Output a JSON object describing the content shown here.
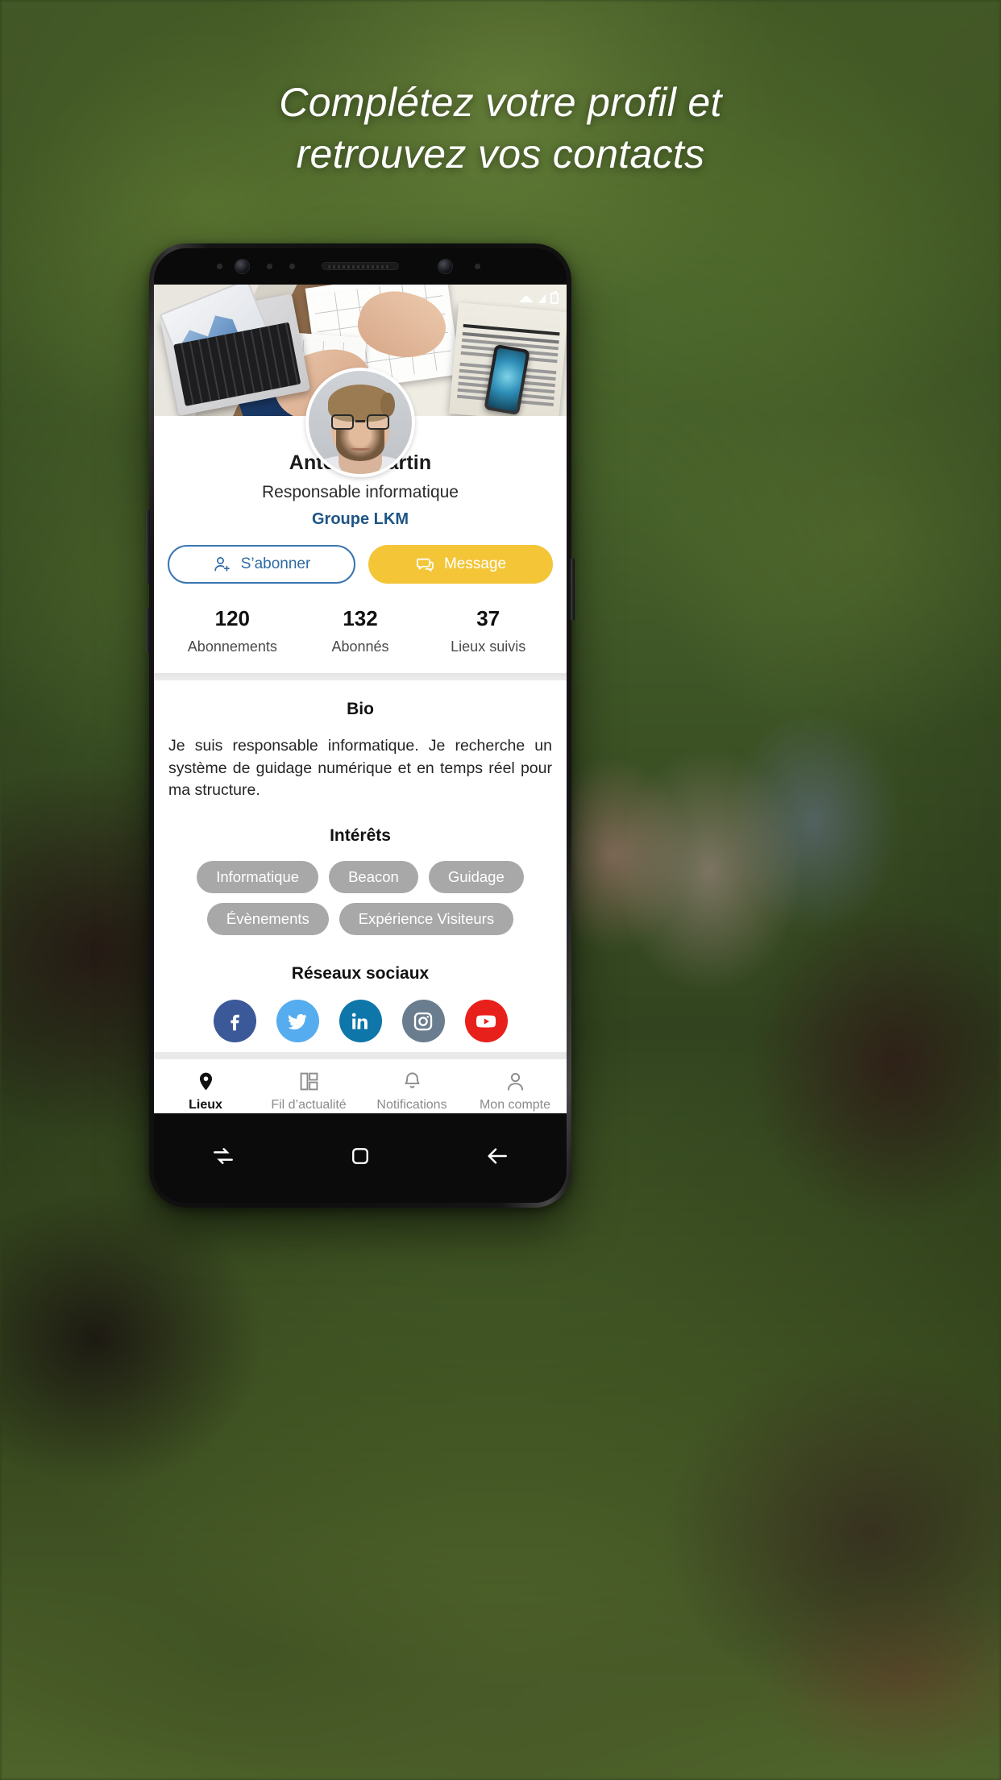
{
  "headline": {
    "line1": "Complétez votre profil et",
    "line2": "retrouvez vos contacts"
  },
  "status_bar": {
    "wifi_icon": "wifi-icon",
    "signal_icon": "signal-icon",
    "battery_icon": "battery-icon"
  },
  "profile": {
    "name": "Antoine Martin",
    "role": "Responsable informatique",
    "company": "Groupe LKM",
    "avatar_icon": "avatar",
    "actions": {
      "subscribe_label": "S’abonner",
      "subscribe_icon": "person-add-icon",
      "message_label": "Message",
      "message_icon": "chat-bubble-icon",
      "subscribe_color": "#2f6ba6",
      "message_color": "#f3c537"
    },
    "stats": [
      {
        "value": "120",
        "label": "Abonnements"
      },
      {
        "value": "132",
        "label": "Abonnés"
      },
      {
        "value": "37",
        "label": "Lieux suivis"
      }
    ]
  },
  "bio": {
    "title": "Bio",
    "text": "Je suis responsable informatique. Je recherche un système de guidage numérique et en temps réel pour ma structure."
  },
  "interests": {
    "title": "Intérêts",
    "tags": [
      "Informatique",
      "Beacon",
      "Guidage",
      "Évènements",
      "Expérience Visiteurs"
    ]
  },
  "socials": {
    "title": "Réseaux sociaux",
    "items": [
      {
        "name": "facebook",
        "icon": "facebook-icon",
        "color": "#3b5998"
      },
      {
        "name": "twitter",
        "icon": "twitter-icon",
        "color": "#55acee"
      },
      {
        "name": "linkedin",
        "icon": "linkedin-icon",
        "color": "#0e76a8"
      },
      {
        "name": "instagram",
        "icon": "instagram-icon",
        "color": "#6a7d8e"
      },
      {
        "name": "youtube",
        "icon": "youtube-icon",
        "color": "#e8201b"
      }
    ]
  },
  "bottom_nav": {
    "items": [
      {
        "label": "Lieux",
        "icon": "map-pin-icon",
        "active": true
      },
      {
        "label": "Fil d’actualité",
        "icon": "dashboard-icon",
        "active": false
      },
      {
        "label": "Notifications",
        "icon": "bell-icon",
        "active": false
      },
      {
        "label": "Mon compte",
        "icon": "person-icon",
        "active": false
      }
    ]
  },
  "android_keys": {
    "recents": "recents-key",
    "home": "home-key",
    "back": "back-key"
  }
}
